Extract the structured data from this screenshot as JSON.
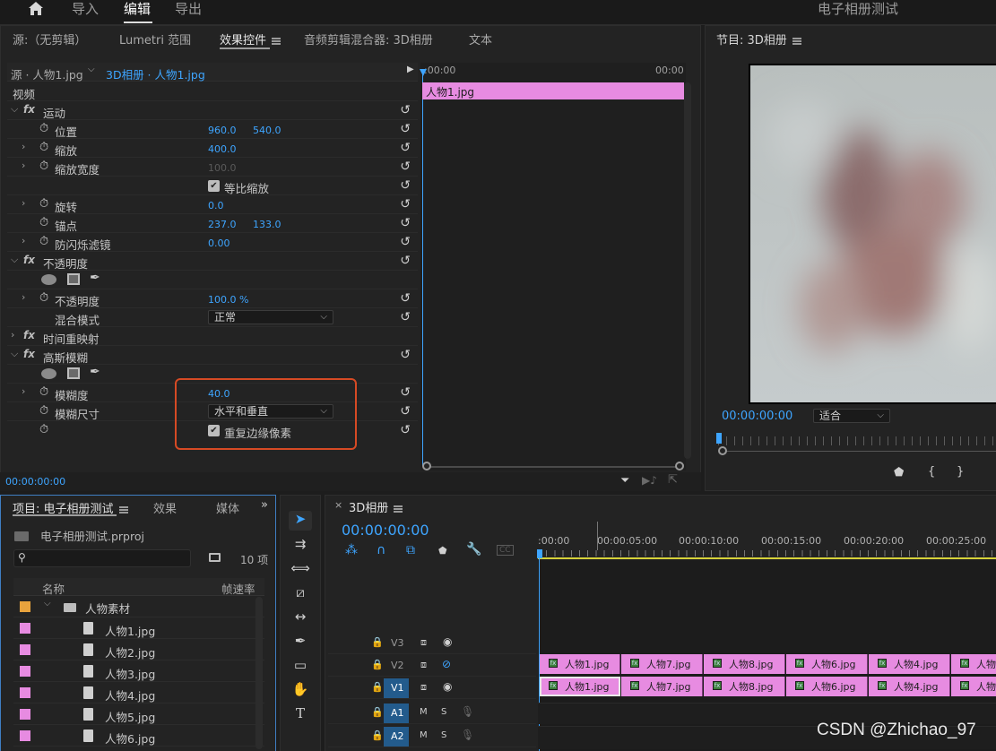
{
  "topbar": {
    "home_icon": "home-icon",
    "tabs": [
      "导入",
      "编辑",
      "导出"
    ],
    "active_tab": "编辑",
    "project_title": "电子相册测试"
  },
  "effect_panel": {
    "tabs": [
      "源:（无剪辑）",
      "Lumetri 范围",
      "效果控件",
      "音频剪辑混合器: 3D相册",
      "文本"
    ],
    "source_label": "源 · 人物1.jpg",
    "sequence_clip": "3D相册 · 人物1.jpg",
    "tc_start": ":00:00",
    "tc_end": "00:00",
    "clip_name": "人物1.jpg",
    "video_label": "视频",
    "motion": "运动",
    "position_label": "位置",
    "position_x": "960.0",
    "position_y": "540.0",
    "scale_label": "缩放",
    "scale_val": "400.0",
    "scale_width_label": "缩放宽度",
    "scale_width_val": "100.0",
    "uniform_scale": "等比缩放",
    "rotation_label": "旋转",
    "rotation_val": "0.0",
    "anchor_label": "锚点",
    "anchor_x": "237.0",
    "anchor_y": "133.0",
    "antiflicker_label": "防闪烁滤镜",
    "antiflicker_val": "0.00",
    "opacity_group": "不透明度",
    "opacity_label": "不透明度",
    "opacity_val": "100.0 %",
    "blend_label": "混合模式",
    "blend_val": "正常",
    "time_remap": "时间重映射",
    "gaussian": "高斯模糊",
    "blurriness_label": "模糊度",
    "blurriness_val": "40.0",
    "blur_dim_label": "模糊尺寸",
    "blur_dim_val": "水平和垂直",
    "repeat_edge": "重复边缘像素",
    "bottom_tc": "00:00:00:00"
  },
  "program": {
    "title": "节目: 3D相册",
    "timecode": "00:00:00:00",
    "fit": "适合"
  },
  "project": {
    "tabs": [
      "项目: 电子相册测试",
      "效果",
      "媒体"
    ],
    "file": "电子相册测试.prproj",
    "count": "10 项",
    "col_name": "名称",
    "col_fps": "帧速率",
    "bin": "人物素材",
    "items": [
      "人物1.jpg",
      "人物2.jpg",
      "人物3.jpg",
      "人物4.jpg",
      "人物5.jpg",
      "人物6.jpg"
    ],
    "colors": {
      "bin": "#e8a33d",
      "clip": "#e78be1"
    }
  },
  "timeline": {
    "title": "3D相册",
    "timecode": "00:00:00:00",
    "ruler": [
      ":00:00",
      "00:00:05:00",
      "00:00:10:00",
      "00:00:15:00",
      "00:00:20:00",
      "00:00:25:00"
    ],
    "tracks": [
      "V3",
      "V2",
      "V1",
      "A1",
      "A2"
    ],
    "v2_clips": [
      "人物1.jpg",
      "人物7.jpg",
      "人物8.jpg",
      "人物6.jpg",
      "人物4.jpg",
      "人物"
    ],
    "v1_clips": [
      "人物1.jpg",
      "人物7.jpg",
      "人物8.jpg",
      "人物6.jpg",
      "人物4.jpg",
      "人物"
    ],
    "m": "M",
    "s": "S"
  },
  "watermark": "CSDN @Zhichao_97"
}
